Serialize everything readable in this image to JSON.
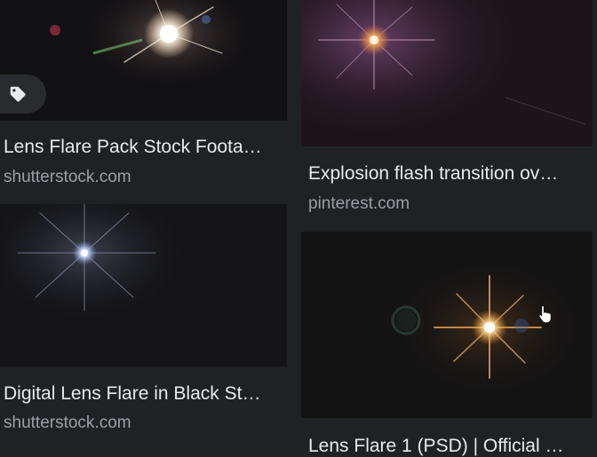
{
  "results": [
    {
      "title": "Lens Flare Pack Stock Foota…",
      "source": "shutterstock.com",
      "thumb_icon": "lens-flare-image",
      "badge_icon": "tag-icon"
    },
    {
      "title": "Explosion flash transition ov…",
      "source": "pinterest.com",
      "thumb_icon": "purple-lens-flare-image"
    },
    {
      "title": "Digital Lens Flare in Black St…",
      "source": "shutterstock.com",
      "thumb_icon": "blue-lens-flare-image"
    },
    {
      "title": "Lens Flare 1 (PSD) | Official …",
      "source": "",
      "thumb_icon": "golden-lens-flare-image"
    }
  ],
  "cursor_icon": "hand-pointer-icon",
  "colors": {
    "background": "#202124",
    "title_text": "#e8eaed",
    "source_text": "#9aa0a6",
    "badge_bg": "#2a2b2e"
  }
}
